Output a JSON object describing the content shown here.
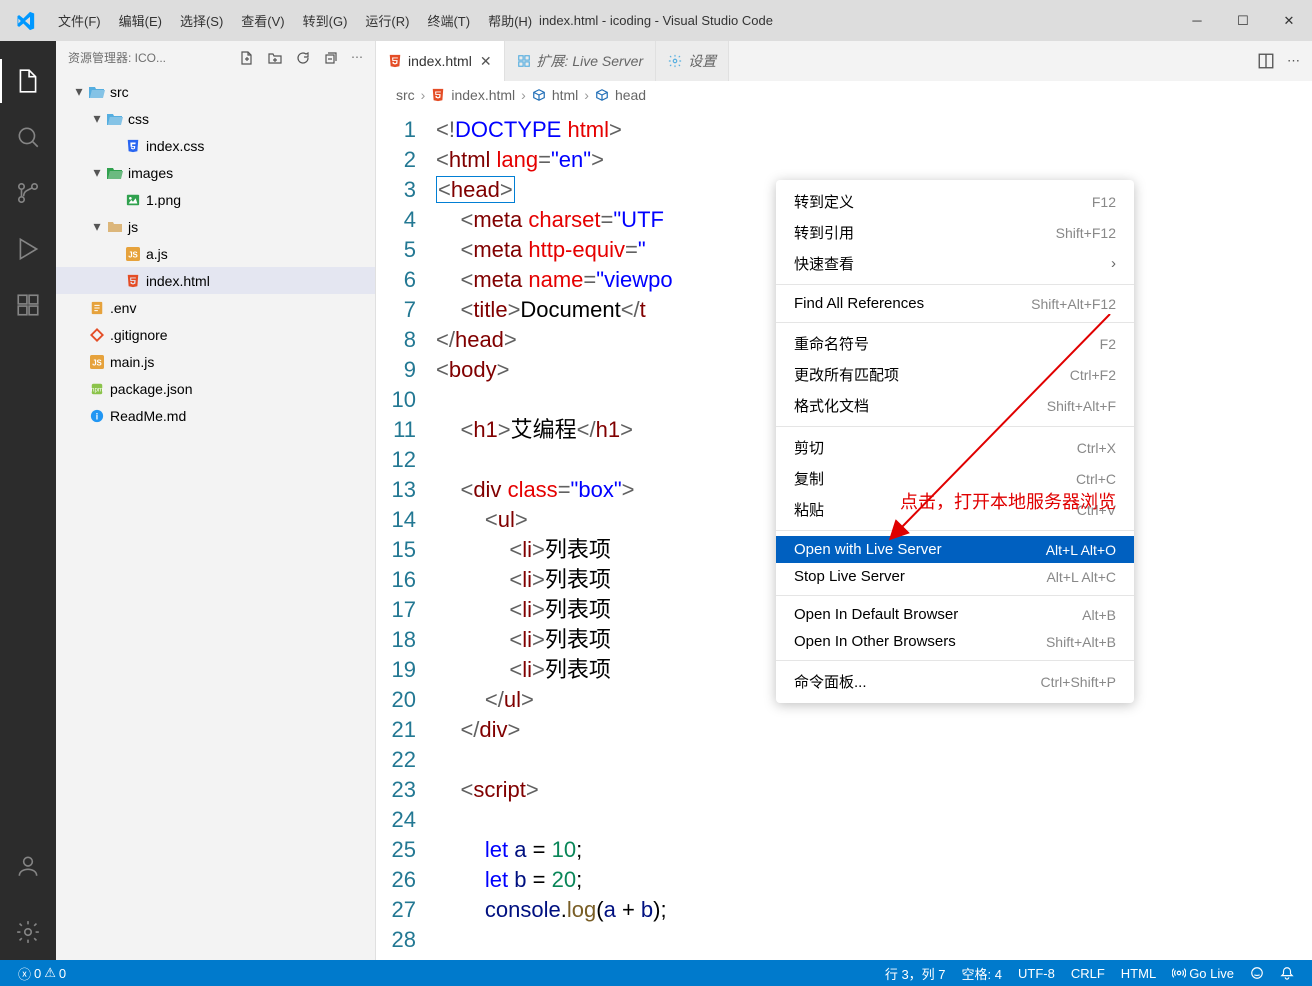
{
  "title": "index.html - icoding - Visual Studio Code",
  "menus": [
    "文件(F)",
    "编辑(E)",
    "选择(S)",
    "查看(V)",
    "转到(G)",
    "运行(R)",
    "终端(T)",
    "帮助(H)"
  ],
  "sidebar": {
    "title": "资源管理器: ICO...",
    "tree": [
      {
        "depth": 0,
        "chev": "▾",
        "type": "folder-open",
        "color": "#55aee0",
        "label": "src"
      },
      {
        "depth": 1,
        "chev": "▾",
        "type": "folder-open",
        "color": "#55aee0",
        "label": "css"
      },
      {
        "depth": 2,
        "chev": "",
        "type": "file",
        "icon": "css",
        "color": "#2965f1",
        "label": "index.css"
      },
      {
        "depth": 1,
        "chev": "▾",
        "type": "folder-open",
        "color": "#30a14e",
        "label": "images"
      },
      {
        "depth": 2,
        "chev": "",
        "type": "file",
        "icon": "img",
        "color": "#30a14e",
        "label": "1.png"
      },
      {
        "depth": 1,
        "chev": "▾",
        "type": "folder",
        "color": "#dcb67a",
        "label": "js"
      },
      {
        "depth": 2,
        "chev": "",
        "type": "file",
        "icon": "js",
        "color": "#e6a23c",
        "label": "a.js"
      },
      {
        "depth": 2,
        "chev": "",
        "type": "file",
        "icon": "html",
        "color": "#e44d26",
        "label": "index.html",
        "selected": true
      },
      {
        "depth": 0,
        "chev": "",
        "type": "file",
        "icon": "env",
        "color": "#e6a23c",
        "label": ".env"
      },
      {
        "depth": 0,
        "chev": "",
        "type": "file",
        "icon": "git",
        "color": "#e44d26",
        "label": ".gitignore"
      },
      {
        "depth": 0,
        "chev": "",
        "type": "file",
        "icon": "js",
        "color": "#e6a23c",
        "label": "main.js"
      },
      {
        "depth": 0,
        "chev": "",
        "type": "file",
        "icon": "pkg",
        "color": "#8bc34a",
        "label": "package.json"
      },
      {
        "depth": 0,
        "chev": "",
        "type": "file",
        "icon": "info",
        "color": "#2196f3",
        "label": "ReadMe.md"
      }
    ]
  },
  "tabs": [
    {
      "icon": "html",
      "color": "#e44d26",
      "label": "index.html",
      "active": true
    },
    {
      "icon": "ext",
      "color": "#55aee0",
      "label": "扩展: Live Server"
    },
    {
      "icon": "set",
      "color": "#55aee0",
      "label": "设置"
    }
  ],
  "breadcrumb": [
    {
      "label": "src"
    },
    {
      "icon": "html",
      "color": "#e44d26",
      "label": "index.html"
    },
    {
      "icon": "cube",
      "color": "#2370b8",
      "label": "html"
    },
    {
      "icon": "cube",
      "color": "#2370b8",
      "label": "head"
    }
  ],
  "codeLines": 28,
  "ctx": [
    {
      "label": "转到定义",
      "sc": "F12"
    },
    {
      "label": "转到引用",
      "sc": "Shift+F12"
    },
    {
      "label": "快速查看",
      "chev": true
    },
    {
      "sep": true
    },
    {
      "label": "Find All References",
      "sc": "Shift+Alt+F12"
    },
    {
      "sep": true
    },
    {
      "label": "重命名符号",
      "sc": "F2"
    },
    {
      "label": "更改所有匹配项",
      "sc": "Ctrl+F2"
    },
    {
      "label": "格式化文档",
      "sc": "Shift+Alt+F"
    },
    {
      "sep": true
    },
    {
      "label": "剪切",
      "sc": "Ctrl+X"
    },
    {
      "label": "复制",
      "sc": "Ctrl+C"
    },
    {
      "label": "粘贴",
      "sc": "Ctrl+V"
    },
    {
      "sep": true
    },
    {
      "label": "Open with Live Server",
      "sc": "Alt+L Alt+O",
      "hov": true
    },
    {
      "label": "Stop Live Server",
      "sc": "Alt+L Alt+C"
    },
    {
      "sep": true
    },
    {
      "label": "Open In Default Browser",
      "sc": "Alt+B"
    },
    {
      "label": "Open In Other Browsers",
      "sc": "Shift+Alt+B"
    },
    {
      "sep": true
    },
    {
      "label": "命令面板...",
      "sc": "Ctrl+Shift+P"
    }
  ],
  "annotation": "点击，打开本地服务器浏览",
  "status": {
    "errors": "0",
    "warnings": "0",
    "position": "行 3，列 7",
    "spaces": "空格: 4",
    "encoding": "UTF-8",
    "eol": "CRLF",
    "lang": "HTML",
    "golive": "Go Live"
  }
}
